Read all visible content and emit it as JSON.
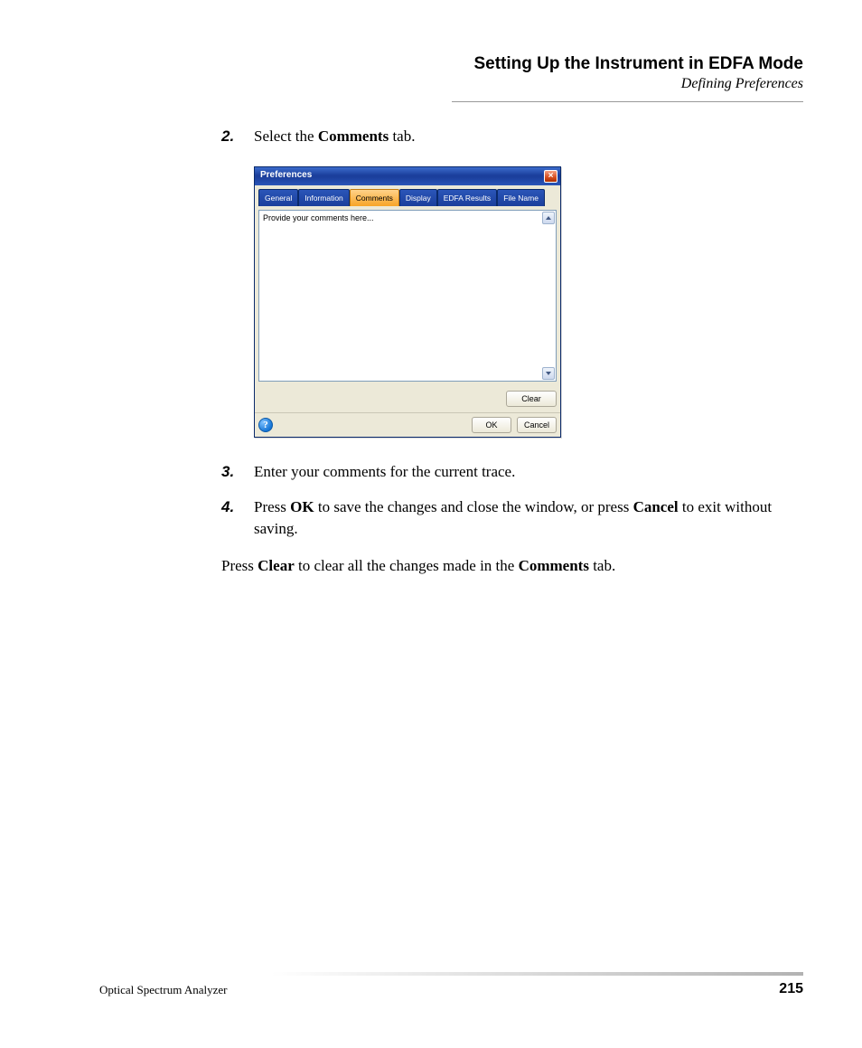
{
  "header": {
    "title": "Setting Up the Instrument in EDFA Mode",
    "subtitle": "Defining Preferences"
  },
  "steps": [
    {
      "num": "2.",
      "pre": "Select the ",
      "bold1": "Comments",
      "post": " tab."
    },
    {
      "num": "3.",
      "text": "Enter your comments for the current trace."
    },
    {
      "num": "4.",
      "pre": "Press ",
      "bold1": "OK",
      "mid": " to save the changes and close the window, or press ",
      "bold2": "Cancel",
      "post": " to exit without saving."
    }
  ],
  "paragraph": {
    "pre": "Press ",
    "bold1": "Clear",
    "mid": " to clear all the changes made in the ",
    "bold2": "Comments",
    "post": " tab."
  },
  "dialog": {
    "title": "Preferences",
    "tabs": [
      "General",
      "Information",
      "Comments",
      "Display",
      "EDFA Results",
      "File Name"
    ],
    "active_tab_index": 2,
    "textarea_text": "Provide your comments here...",
    "clear_label": "Clear",
    "ok_label": "OK",
    "cancel_label": "Cancel",
    "help_glyph": "?"
  },
  "footer": {
    "left": "Optical Spectrum Analyzer",
    "page": "215"
  }
}
